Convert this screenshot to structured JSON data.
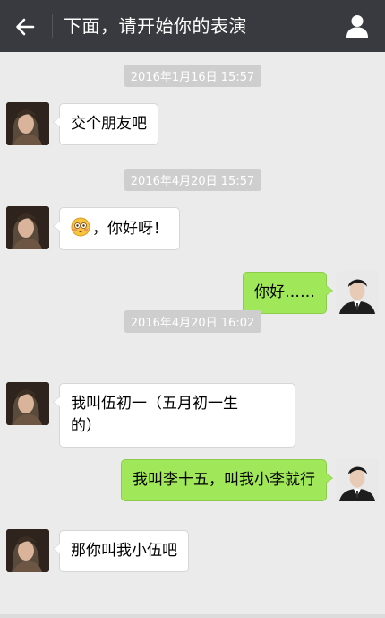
{
  "header": {
    "title": "下面，请开始你的表演",
    "back_icon": "arrow-left-icon",
    "profile_icon": "person-icon"
  },
  "colors": {
    "topbar": "#393a3f",
    "background": "#ebebeb",
    "sent_bubble": "#a0e75a",
    "received_bubble": "#ffffff",
    "timestamp_bg": "#cecece"
  },
  "timestamps": [
    "2016年1月16日 15:57",
    "2016年4月20日 15:57",
    "2016年4月20日 16:02"
  ],
  "messages": [
    {
      "side": "left",
      "text": "交个朋友吧"
    },
    {
      "side": "left",
      "emoji": "flushed-face-icon",
      "text": "，你好呀！"
    },
    {
      "side": "right",
      "text": "你好……"
    },
    {
      "side": "left",
      "line1": "我叫伍初一（五月初一生",
      "line2": "的）"
    },
    {
      "side": "right",
      "text": "我叫李十五，叫我小李就行"
    },
    {
      "side": "left",
      "text": "那你叫我小伍吧"
    }
  ]
}
